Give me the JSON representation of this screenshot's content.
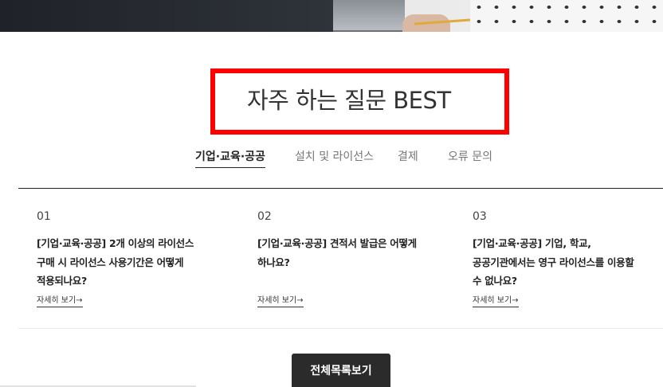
{
  "section_title": "자주 하는 질문 BEST",
  "tabs": [
    {
      "label": "기업·교육·공공",
      "active": true
    },
    {
      "label": "설치 및 라이선스",
      "active": false
    },
    {
      "label": "결제",
      "active": false
    },
    {
      "label": "오류 문의",
      "active": false
    }
  ],
  "faq": [
    {
      "number": "01",
      "lines": [
        "[기업·교육·공공] 2개 이상의 라이선스",
        "구매 시 라이선스 사용기간은 어떻게",
        "적용되나요?"
      ],
      "more": "자세히 보기→"
    },
    {
      "number": "02",
      "lines": [
        "[기업·교육·공공] 견적서 발급은 어떻게",
        "하나요?",
        ""
      ],
      "more": "자세히 보기→"
    },
    {
      "number": "03",
      "lines": [
        "[기업·교육·공공] 기업, 학교,",
        "공공기관에서는 영구 라이선스를 이용할",
        "수 없나요?"
      ],
      "more": "자세히 보기→"
    }
  ],
  "view_all_button": "전체목록보기",
  "colors": {
    "highlight_box": "#ff0000",
    "button_bg": "#2b2b2b"
  }
}
